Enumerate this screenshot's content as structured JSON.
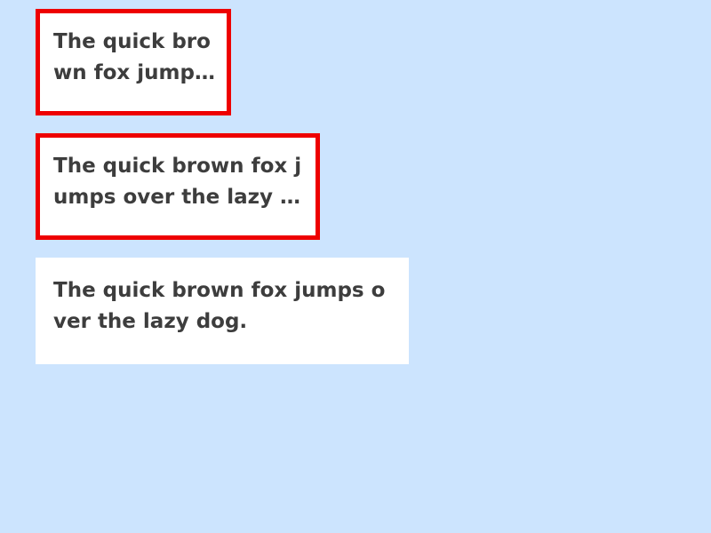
{
  "boxes": [
    {
      "text": "The quick brown fox jumps over the lazy dog.",
      "state": "truncated"
    },
    {
      "text": "The quick brown fox jumps over the lazy dog.",
      "state": "truncated"
    },
    {
      "text": "The quick brown fox jumps over the lazy dog.",
      "state": "full"
    }
  ],
  "colors": {
    "background": "#cce4fe",
    "box_background": "#ffffff",
    "overflow_border": "#ee0000",
    "text": "#3d3d3d"
  }
}
